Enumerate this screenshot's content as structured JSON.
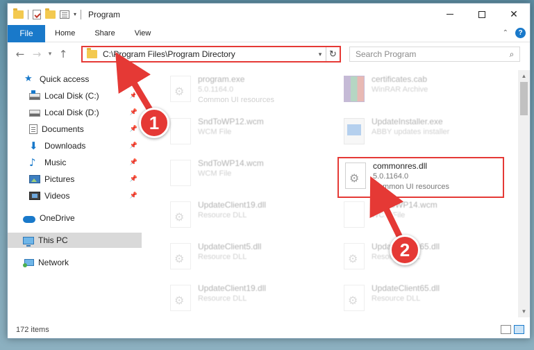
{
  "window": {
    "title": "Program",
    "controls": {
      "minimize": "–",
      "maximize": "□",
      "close": "✕"
    }
  },
  "ribbon": {
    "tabs": [
      "File",
      "Home",
      "Share",
      "View"
    ]
  },
  "nav": {
    "address": "C:\\Program Files\\Program Directory",
    "search_placeholder": "Search Program"
  },
  "sidebar": {
    "items": [
      {
        "label": "Quick access",
        "icon": "star-icon",
        "pinned": false
      },
      {
        "label": "Local Disk (C:)",
        "icon": "local-disk-icon",
        "pinned": true
      },
      {
        "label": "Local Disk (D:)",
        "icon": "local-disk-icon",
        "pinned": true
      },
      {
        "label": "Documents",
        "icon": "documents-icon",
        "pinned": true
      },
      {
        "label": "Downloads",
        "icon": "downloads-icon",
        "pinned": true
      },
      {
        "label": "Music",
        "icon": "music-icon",
        "pinned": true
      },
      {
        "label": "Pictures",
        "icon": "pictures-icon",
        "pinned": true
      },
      {
        "label": "Videos",
        "icon": "videos-icon",
        "pinned": true
      },
      {
        "label": "OneDrive",
        "icon": "onedrive-icon",
        "pinned": false
      },
      {
        "label": "This PC",
        "icon": "this-pc-icon",
        "pinned": false,
        "selected": true
      },
      {
        "label": "Network",
        "icon": "network-icon",
        "pinned": false
      }
    ]
  },
  "files": [
    {
      "name": "program.exe",
      "line1": "5.0.1164.0",
      "line2": "Common UI resources",
      "icon": "gear-file-icon"
    },
    {
      "name": "certificates.cab",
      "line1": "WinRAR Archive",
      "line2": "",
      "icon": "winrar-icon"
    },
    {
      "name": "SndToWP12.wcm",
      "line1": "WCM File",
      "line2": "",
      "icon": "blank-file-icon"
    },
    {
      "name": "UpdateInstaller.exe",
      "line1": "ABBY updates installer",
      "line2": "",
      "icon": "exe-icon"
    },
    {
      "name": "SndToWP14.wcm",
      "line1": "WCM File",
      "line2": "",
      "icon": "blank-file-icon"
    },
    {
      "name": "commonres.dll",
      "line1": "5.0.1164.0",
      "line2": "Common UI resources",
      "icon": "gear-file-icon",
      "highlight": true
    },
    {
      "name": "UpdateClient19.dll",
      "line1": "Resource DLL",
      "line2": "",
      "icon": "gear-file-icon"
    },
    {
      "name": "SndToWP14.wcm",
      "line1": "WCM File",
      "line2": "",
      "icon": "blank-file-icon"
    },
    {
      "name": "UpdateClient5.dll",
      "line1": "Resource DLL",
      "line2": "",
      "icon": "gear-file-icon"
    },
    {
      "name": "UpdateClient65.dll",
      "line1": "Resource DLL",
      "line2": "",
      "icon": "gear-file-icon"
    },
    {
      "name": "UpdateClient19.dll",
      "line1": "Resource DLL",
      "line2": "",
      "icon": "gear-file-icon"
    },
    {
      "name": "UpdateClient65.dll",
      "line1": "Resource DLL",
      "line2": "",
      "icon": "gear-file-icon"
    }
  ],
  "status": {
    "items_count": "172 items"
  },
  "annotations": {
    "step1": "1",
    "step2": "2",
    "color": "#e53935"
  }
}
